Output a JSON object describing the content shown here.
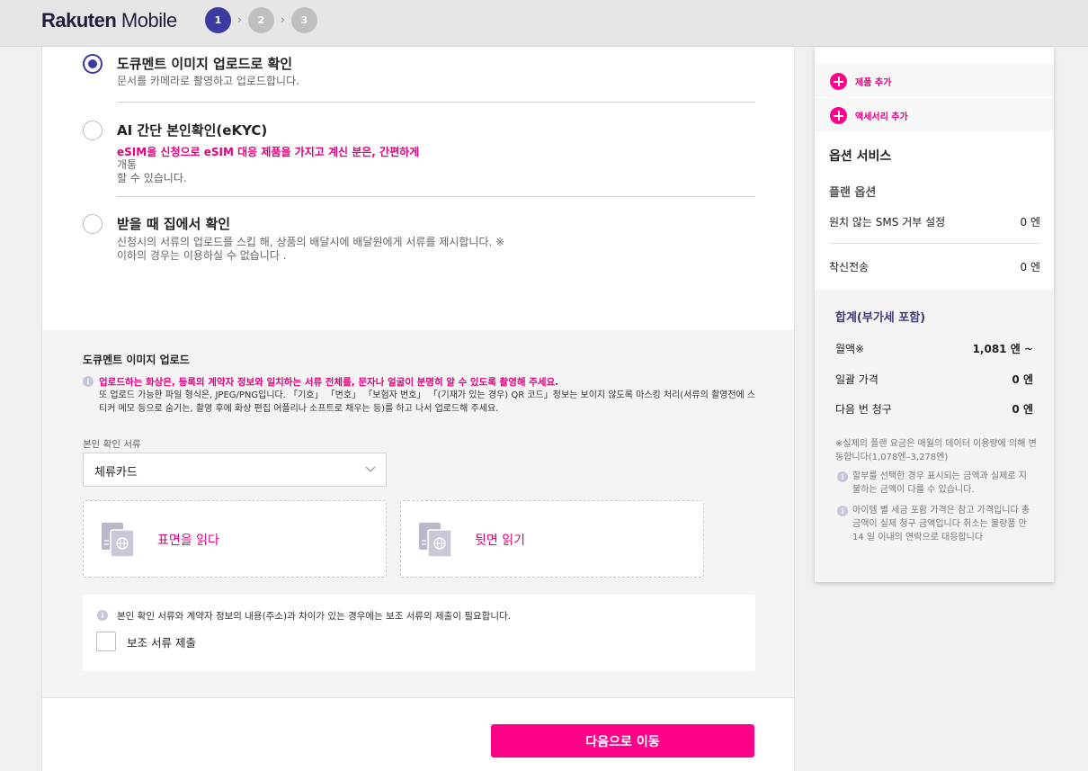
{
  "header": {
    "logo_bold": "Rakuten",
    "logo_light": " Mobile",
    "steps": [
      "1",
      "2",
      "3"
    ]
  },
  "options": [
    {
      "title": "도큐멘트 이미지 업로드로 확인",
      "desc": "문서를 카메라로 촬영하고 업로드합니다.",
      "selected": true
    },
    {
      "title": "AI 간단 본인확인(eKYC)",
      "highlight": "eSIM을 신청으로 eSIM 대응 제품을 가지고 계신 분은, 간편하게",
      "desc_line1": "개통",
      "desc_line2": "할 수 있습니다.",
      "selected": false
    },
    {
      "title": "받을 때 집에서 확인",
      "desc_line1": "신청시의 서류의 업로드를 스킵 해, 상품의 배달시에 배달원에게 서류를 제시합니다. ※",
      "desc_line2": "이하의 경우는 이용하실 수 없습니다 .",
      "selected": false
    }
  ],
  "upload": {
    "title": "도큐멘트 이미지 업로드",
    "warning": "업로드하는 화상은, 등록의 계약자 정보와 일치하는 서류 전체를, 문자나 얼굴이 분명히 알 수 있도록 촬영해 주세요.",
    "note": "또 업로드 가능한 파일 형식은, JPEG/PNG입니다. 「기호」 「번호」 「보험자 번호」 「(기재가 있는 경우) QR 코드」정보는 보이지 않도록 마스킹 처리(서류의 촬영전에 스티커 메모 등으로 숨기는, 촬영 후에 화상 편집 어플리나 소프트로 채우는 등)를 하고 나서 업로드해 주세요.",
    "select_label": "본인 확인 서류",
    "select_value": "체류카드",
    "front_label": "표면을 읽다",
    "back_label": "뒷면 읽기",
    "sub_note": "본인 확인 서류와 계약자 정보의 내용(주소)과 차이가 있는 경우에는 보조 서류의 제출이 필요합니다.",
    "sub_checkbox_label": "보조 서류 제출",
    "sub_checked": false
  },
  "next_button": "다음으로 이동",
  "sidebar": {
    "add_product": "제품 추가",
    "add_accessory": "액세서리 추가",
    "option_service": "옵션 서비스",
    "plan_option": "플랜 옵션",
    "rows": [
      {
        "label": "원치 않는 SMS 거부 설정",
        "value": "0 엔"
      },
      {
        "label": "착신전송",
        "value": "0 엔"
      }
    ],
    "total": {
      "title": "합계(부가세 포함)",
      "monthly_label": "월액※",
      "monthly_value": "1,081 엔 ~",
      "lump_label": "일괄 가격",
      "lump_value": "0 엔",
      "next_label": "다음 번 청구",
      "next_value": "0 엔",
      "note": "※실제의 플랜 요금은 매월의 데이터 이용량에 의해 변동합니다(1,078엔–3,278엔)",
      "info1": "할부를 선택한 경우 표시되는 금액과 실제로 지불하는 금액이 다를 수 있습니다.",
      "info2": "아이템 별 세금 포함 가격은 참고 가격입니다 총 금액이 실제 청구 금액입니다 취소는 불량품 만 14 일 이내의 연락으로 대응합니다"
    }
  },
  "colors": {
    "accent_pink": "#ff0089",
    "brand_navy": "#3e3ba0",
    "pink_text": "#e2007e"
  },
  "icons": {
    "step_separator": "chevron-right-icon",
    "select_arrow": "chevron-down-icon",
    "drop_zone": "passport-icon",
    "info": "info-icon",
    "add": "plus-circle-icon"
  }
}
